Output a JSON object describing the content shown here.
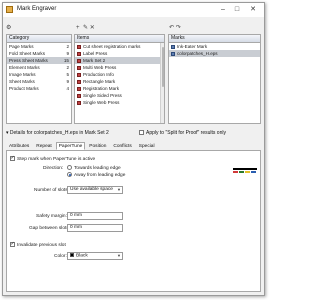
{
  "window": {
    "title": "Mark Engraver",
    "minimize": "–",
    "maximize": "□",
    "close": "✕"
  },
  "toolbar": {
    "settings_glyph": "⚙",
    "marks_add_glyph": "+",
    "marks_tools_glyph": "✎ ✕",
    "right_tools_glyph": "↶ ↷"
  },
  "category_panel": {
    "header": "Category",
    "items": [
      {
        "label": "Page Marks",
        "count": "2"
      },
      {
        "label": "Fold Sheet Marks",
        "count": "9"
      },
      {
        "label": "Press Sheet Marks",
        "count": "15"
      },
      {
        "label": "Element Marks",
        "count": "2"
      },
      {
        "label": "Image Marks",
        "count": "5"
      },
      {
        "label": "Sheet Marks",
        "count": "9"
      },
      {
        "label": "Product Marks",
        "count": "4"
      }
    ]
  },
  "items_panel": {
    "header": "Items",
    "items": [
      {
        "label": "Cut sheet registration marks"
      },
      {
        "label": "Label Press"
      },
      {
        "label": "Mark Set 2"
      },
      {
        "label": "Multi Web Press"
      },
      {
        "label": "Production Info"
      },
      {
        "label": "Rectangle Mark"
      },
      {
        "label": "Registration Mark"
      },
      {
        "label": "Single Sided Press"
      },
      {
        "label": "Single Web Press"
      }
    ]
  },
  "marks_panel": {
    "header": "Marks",
    "items": [
      {
        "label": "Ink-Eater Mark"
      },
      {
        "label": "colorpatches_H.eps"
      }
    ]
  },
  "details": {
    "label": "Details for colorpatches_H.eps in Mark Set 2",
    "apply_label": "Apply to \"Split for Proof\" results only"
  },
  "tabs": [
    {
      "label": "Attributes"
    },
    {
      "label": "Repeat"
    },
    {
      "label": "PaperTune"
    },
    {
      "label": "Position"
    },
    {
      "label": "Conflicts"
    },
    {
      "label": "Special"
    }
  ],
  "papertune": {
    "step_mark_label": "Step mark when PaperTune is active",
    "direction_label": "Direction:",
    "towards_label": "Towards leading edge",
    "away_label": "Away from leading edge",
    "slots_label": "Number of slots:",
    "slots_value": "Use available space",
    "safety_label": "Safety margin:",
    "safety_value": "0 mm",
    "gap_label": "Gap between slots:",
    "gap_value": "0 mm",
    "invalidate_label": "Invalidate previous slot",
    "color_label": "Color:",
    "color_value": "Black",
    "color_swatch": "#000000"
  },
  "colors": {
    "selection": "#c9cdd3",
    "accent": "#2a5db0"
  }
}
